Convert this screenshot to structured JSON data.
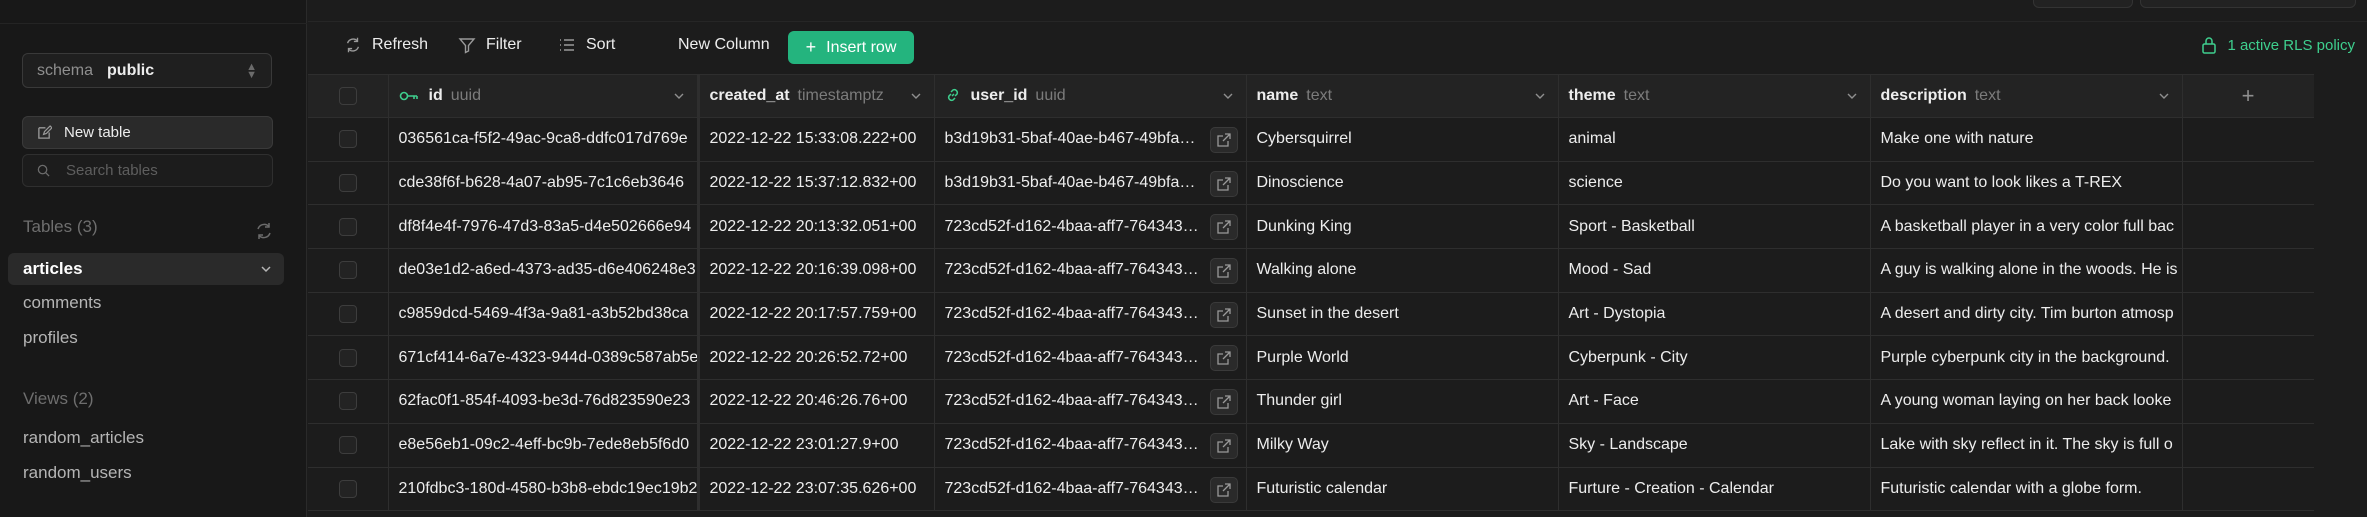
{
  "sidebar": {
    "schema": {
      "label": "schema",
      "value": "public"
    },
    "new_table_label": "New table",
    "search_placeholder": "Search tables",
    "tables_header": "Tables (3)",
    "tables": [
      "articles",
      "comments",
      "profiles"
    ],
    "views_header": "Views (2)",
    "views": [
      "random_articles",
      "random_users"
    ]
  },
  "toolbar": {
    "refresh": "Refresh",
    "filter": "Filter",
    "sort": "Sort",
    "new_column": "New Column",
    "insert_row": "Insert row",
    "rls": "1 active RLS policy"
  },
  "grid": {
    "columns": [
      {
        "name": "id",
        "type": "uuid"
      },
      {
        "name": "created_at",
        "type": "timestamptz"
      },
      {
        "name": "user_id",
        "type": "uuid"
      },
      {
        "name": "name",
        "type": "text"
      },
      {
        "name": "theme",
        "type": "text"
      },
      {
        "name": "description",
        "type": "text"
      }
    ],
    "rows": [
      [
        "036561ca-f5f2-49ac-9ca8-ddfc017d769e",
        "2022-12-22 15:33:08.222+00",
        "b3d19b31-5baf-40ae-b467-49bfa2…",
        "Cybersquirrel",
        "animal",
        "Make one with nature"
      ],
      [
        "cde38f6f-b628-4a07-ab95-7c1c6eb3646",
        "2022-12-22 15:37:12.832+00",
        "b3d19b31-5baf-40ae-b467-49bfa2…",
        "Dinoscience",
        "science",
        "Do you want to look likes a T-REX"
      ],
      [
        "df8f4e4f-7976-47d3-83a5-d4e502666e94",
        "2022-12-22 20:13:32.051+00",
        "723cd52f-d162-4baa-aff7-764343e…",
        "Dunking King",
        "Sport - Basketball",
        "A basketball player in a very color full bac"
      ],
      [
        "de03e1d2-a6ed-4373-ad35-d6e406248e3",
        "2022-12-22 20:16:39.098+00",
        "723cd52f-d162-4baa-aff7-764343e…",
        "Walking alone",
        "Mood - Sad",
        "A guy is walking alone in the woods. He is"
      ],
      [
        "c9859dcd-5469-4f3a-9a81-a3b52bd38ca",
        "2022-12-22 20:17:57.759+00",
        "723cd52f-d162-4baa-aff7-764343e…",
        "Sunset in the desert",
        "Art - Dystopia",
        "A desert and dirty city. Tim burton atmosp"
      ],
      [
        "671cf414-6a7e-4323-944d-0389c587ab5e",
        "2022-12-22 20:26:52.72+00",
        "723cd52f-d162-4baa-aff7-764343e…",
        "Purple World",
        "Cyberpunk - City",
        "Purple cyberpunk city in the background."
      ],
      [
        "62fac0f1-854f-4093-be3d-76d823590e23",
        "2022-12-22 20:46:26.76+00",
        "723cd52f-d162-4baa-aff7-764343e…",
        "Thunder girl",
        "Art - Face",
        "A young woman laying on her back looke"
      ],
      [
        "e8e56eb1-09c2-4eff-bc9b-7ede8eb5f6d0",
        "2022-12-22 23:01:27.9+00",
        "723cd52f-d162-4baa-aff7-764343e…",
        "Milky Way",
        "Sky - Landscape",
        "Lake with sky reflect in it. The sky is full o"
      ],
      [
        "210fdbc3-180d-4580-b3b8-ebdc19ec19b2",
        "2022-12-22 23:07:35.626+00",
        "723cd52f-d162-4baa-aff7-764343e…",
        "Futuristic calendar",
        "Furture - Creation - Calendar",
        "Futuristic calendar with a globe form."
      ]
    ]
  },
  "colors": {
    "accent": "#24b47e",
    "rls": "#3ecf8e",
    "background": "#1c1c1c",
    "sidebar": "#181818"
  },
  "icons": [
    "refresh-icon",
    "filter-icon",
    "sort-icon",
    "plus-icon",
    "lock-icon",
    "key-icon",
    "link-icon",
    "external-link-icon",
    "chevron-down-icon",
    "search-icon",
    "edit-icon"
  ]
}
